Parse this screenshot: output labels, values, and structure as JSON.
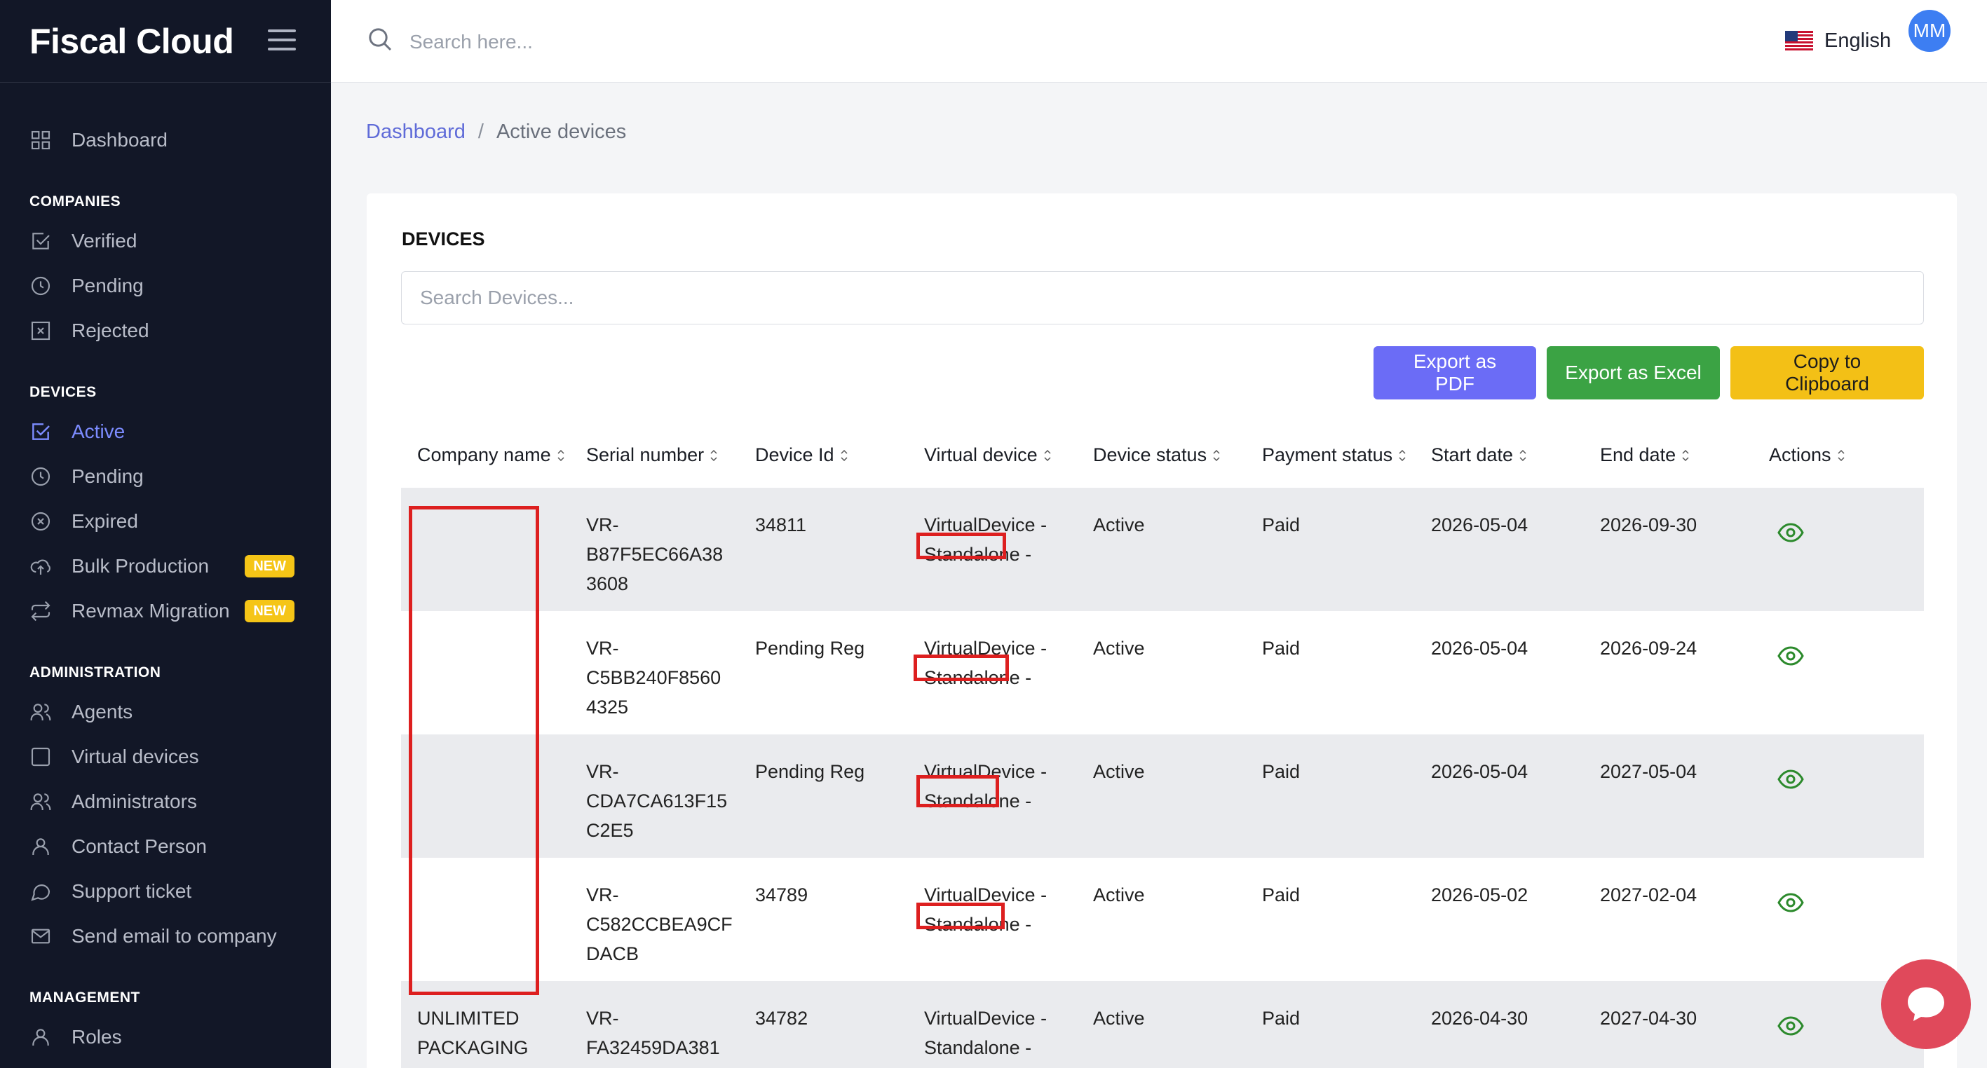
{
  "app": {
    "brand": "Fiscal Cloud"
  },
  "topbar": {
    "search_placeholder": "Search here...",
    "language": "English",
    "avatar_initials": "MM"
  },
  "sidebar": {
    "dashboard": "Dashboard",
    "sections": {
      "companies": "COMPANIES",
      "devices": "DEVICES",
      "administration": "ADMINISTRATION",
      "management": "MANAGEMENT"
    },
    "companies": [
      "Verified",
      "Pending",
      "Rejected"
    ],
    "devices": [
      "Active",
      "Pending",
      "Expired",
      "Bulk Production",
      "Revmax Migration"
    ],
    "badge": "NEW",
    "administration": [
      "Agents",
      "Virtual devices",
      "Administrators",
      "Contact Person",
      "Support ticket",
      "Send email to company"
    ],
    "management": [
      "Roles"
    ]
  },
  "breadcrumb": {
    "root": "Dashboard",
    "separator": "/",
    "current": "Active devices"
  },
  "card": {
    "title": "DEVICES",
    "search_placeholder": "Search Devices...",
    "buttons": {
      "pdf": "Export as PDF",
      "excel": "Export as Excel",
      "clipboard": "Copy to Clipboard"
    }
  },
  "table": {
    "columns": [
      "Company name",
      "Serial number",
      "Device Id",
      "Virtual device",
      "Device status",
      "Payment status",
      "Start date",
      "End date",
      "Actions"
    ],
    "rows": [
      {
        "company_l1": "",
        "company_l2": "",
        "serial_l1": "VR-",
        "serial_l2": "B87F5EC66A38",
        "serial_l3": "3608",
        "device_id": "34811",
        "virtual_l1": "VirtualDevice -",
        "virtual_l2": "Standalone -",
        "status": "Active",
        "payment": "Paid",
        "start": "2026-05-04",
        "end": "2026-09-30"
      },
      {
        "company_l1": "",
        "company_l2": "",
        "serial_l1": "VR-",
        "serial_l2": "C5BB240F8560",
        "serial_l3": "4325",
        "device_id": "Pending Reg",
        "virtual_l1": "VirtualDevice -",
        "virtual_l2": "Standalone -",
        "status": "Active",
        "payment": "Paid",
        "start": "2026-05-04",
        "end": "2026-09-24"
      },
      {
        "company_l1": "",
        "company_l2": "",
        "serial_l1": "VR-",
        "serial_l2": "CDA7CA613F15",
        "serial_l3": "C2E5",
        "device_id": "Pending Reg",
        "virtual_l1": "VirtualDevice -",
        "virtual_l2": "Standalone -",
        "status": "Active",
        "payment": "Paid",
        "start": "2026-05-04",
        "end": "2027-05-04"
      },
      {
        "company_l1": "",
        "company_l2": "",
        "serial_l1": "VR-",
        "serial_l2": "C582CCBEA9CF",
        "serial_l3": "DACB",
        "device_id": "34789",
        "virtual_l1": "VirtualDevice -",
        "virtual_l2": "Standalone -",
        "status": "Active",
        "payment": "Paid",
        "start": "2026-05-02",
        "end": "2027-02-04"
      },
      {
        "company_l1": "UNLIMITED",
        "company_l2": "PACKAGING",
        "serial_l1": "VR-",
        "serial_l2": "FA32459DA381",
        "serial_l3": "",
        "device_id": "34782",
        "virtual_l1": "VirtualDevice -",
        "virtual_l2": "Standalone -",
        "status": "Active",
        "payment": "Paid",
        "start": "2026-04-30",
        "end": "2027-04-30"
      }
    ]
  },
  "colors": {
    "sidebar_bg": "#121727",
    "accent": "#6b6cf6",
    "excel": "#3ba344",
    "clipboard": "#f3c016",
    "status_eye": "#2c8a2c",
    "chat": "#e0495b"
  }
}
